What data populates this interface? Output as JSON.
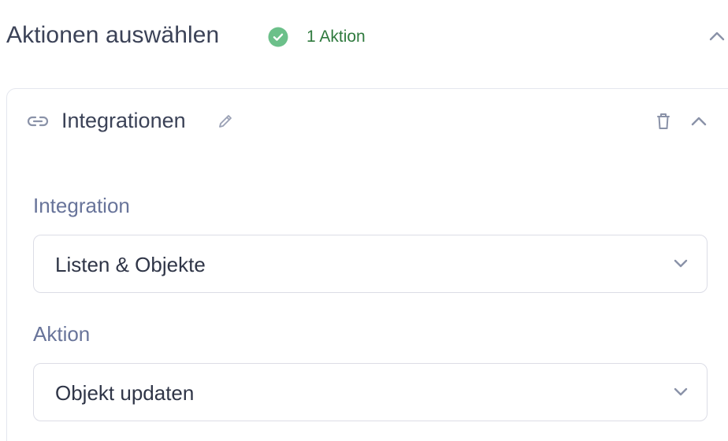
{
  "section": {
    "title": "Aktionen auswählen",
    "count_label": "1 Aktion",
    "status_icon": "check-circle-icon",
    "status_color": "#5cb87a"
  },
  "card": {
    "title": "Integrationen",
    "icon": "link-icon"
  },
  "fields": {
    "integration": {
      "label": "Integration",
      "value": "Listen & Objekte"
    },
    "action": {
      "label": "Aktion",
      "value": "Objekt updaten"
    }
  },
  "colors": {
    "text_primary": "#3b4257",
    "label": "#68749a",
    "success_text": "#2f7a3e",
    "border": "#e4e6ee",
    "icon_muted": "#8a92a8"
  }
}
